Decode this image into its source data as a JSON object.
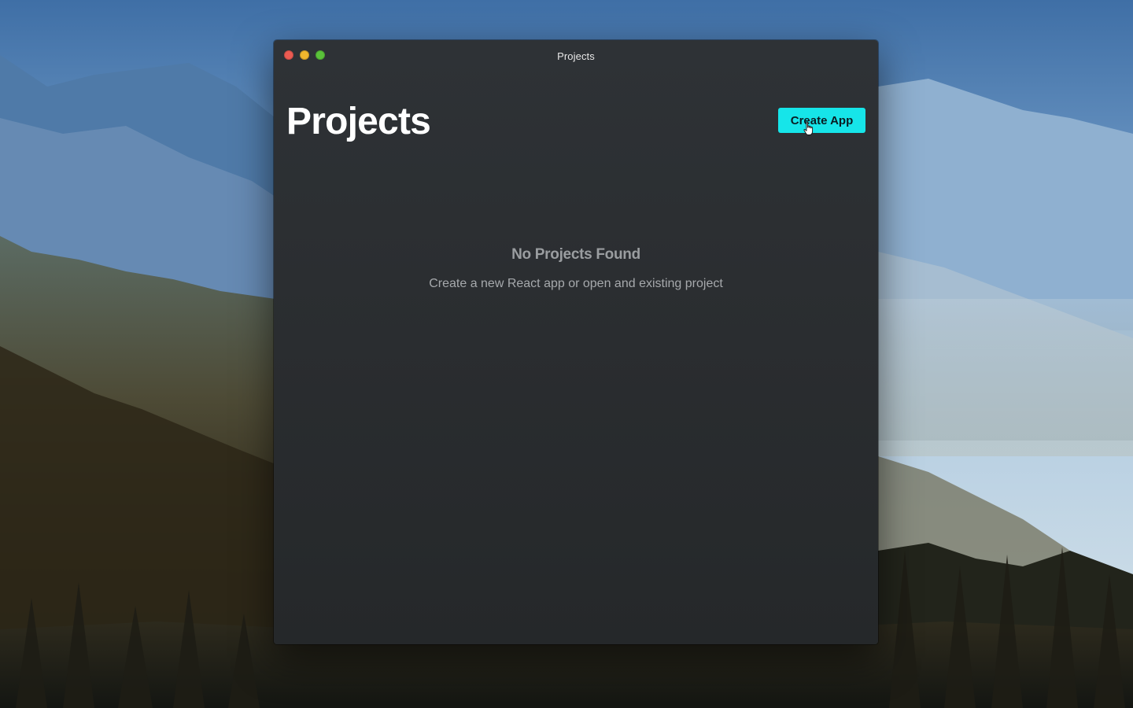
{
  "window": {
    "title": "Projects"
  },
  "page": {
    "title": "Projects",
    "create_button_label": "Create App"
  },
  "empty_state": {
    "title": "No Projects Found",
    "subtitle": "Create a new React app or open and existing project"
  },
  "icons": {
    "close": "traffic-light-close",
    "minimize": "traffic-light-minimize",
    "zoom": "traffic-light-zoom",
    "cursor": "pointing-hand-cursor"
  },
  "colors": {
    "accent": "#16e5e9",
    "window_background": "#2b2e31",
    "close": "#ec5b52",
    "minimize": "#f0b62d",
    "zoom": "#5ac23a"
  }
}
